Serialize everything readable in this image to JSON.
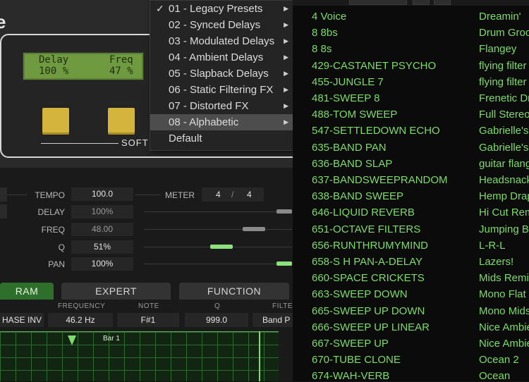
{
  "device": {
    "logo": "e",
    "lcd": {
      "label1": "Delay",
      "value1": "100 %",
      "label2": "Freq",
      "value2": "47 %"
    },
    "soft_label": "SOFT"
  },
  "params": {
    "tempo": {
      "label": "TEMPO",
      "value": "100.0"
    },
    "meter": {
      "label": "METER",
      "num": "4",
      "sep": "/",
      "den": "4"
    },
    "delay": {
      "label": "DELAY",
      "value": "100%"
    },
    "freq": {
      "label": "FREQ",
      "value": "48.00"
    },
    "q": {
      "label": "Q",
      "value": "51%"
    },
    "pan": {
      "label": "PAN",
      "value": "100%"
    },
    "slider_levels": {
      "delay": 1.0,
      "freq": 0.48,
      "q": 0.51,
      "pan": 1.0
    }
  },
  "tabs": [
    "RAM",
    "EXPERT",
    "FUNCTION"
  ],
  "filter": {
    "headers": [
      "FREQUENCY",
      "NOTE",
      "Q",
      "FILTE"
    ],
    "phase_inv": "HASE INV",
    "frequency": "46.2 Hz",
    "note": "F#1",
    "q": "999.0",
    "type": "Band P"
  },
  "sequencer": {
    "bar_label": "Bar 1"
  },
  "menu": {
    "items": [
      {
        "label": "01 - Legacy Presets",
        "checked": true,
        "submenu": true
      },
      {
        "label": "02 - Synced Delays",
        "checked": false,
        "submenu": true
      },
      {
        "label": "03 - Modulated Delays",
        "checked": false,
        "submenu": true
      },
      {
        "label": "04 - Ambient Delays",
        "checked": false,
        "submenu": true
      },
      {
        "label": "05 - Slapback Delays",
        "checked": false,
        "submenu": true
      },
      {
        "label": "06 - Static Filtering FX",
        "checked": false,
        "submenu": true
      },
      {
        "label": "07 - Distorted FX",
        "checked": false,
        "submenu": true
      },
      {
        "label": "08 - Alphabetic",
        "checked": false,
        "submenu": true,
        "active": true
      },
      {
        "label": "Default",
        "checked": false,
        "submenu": false
      }
    ],
    "check_glyph": "✓",
    "arrow_glyph": "▶"
  },
  "presets": {
    "col1": [
      "4 Voice",
      "8 8bs",
      "8 8s",
      "429-CASTANET PSYCHO",
      "455-JUNGLE 7",
      "481-SWEEP 8",
      "488-TOM SWEEP",
      "547-SETTLEDOWN ECHO",
      "635-BAND PAN",
      "636-BAND SLAP",
      "637-BANDSWEEPRANDOM",
      "638-BAND SWEEP",
      "646-LIQUID REVERB",
      "651-OCTAVE FILTERS",
      "656-RUNTHRUMYMIND",
      "658-S H PAN-A-DELAY",
      "660-SPACE CRICKETS",
      "663-SWEEP DOWN",
      "665-SWEEP UP DOWN",
      "666-SWEEP UP LINEAR",
      "667-SWEEP UP",
      "670-TUBE CLONE",
      "674-WAH-VERB"
    ],
    "col2": [
      "Dreamin'",
      "Drum Groo",
      "Flangey",
      "flying filter",
      "flying filter",
      "Frenetic Dr",
      "Full Stereo",
      "Gabrielle's",
      "Gabrielle's",
      "guitar flang",
      "Headsnack",
      "Hemp Drap",
      "Hi Cut Rem",
      "Jumping B",
      "L-R-L",
      "Lazers!",
      "Mids Remi",
      "Mono Flat",
      "Mono Mids",
      "Nice Ambie",
      "Nice Ambie",
      "Ocean 2",
      "Ocean"
    ]
  },
  "colors": {
    "accent_green": "#7ddc6a",
    "lcd_green": "#6f9a3f",
    "button_yellow": "#d4b43c"
  }
}
